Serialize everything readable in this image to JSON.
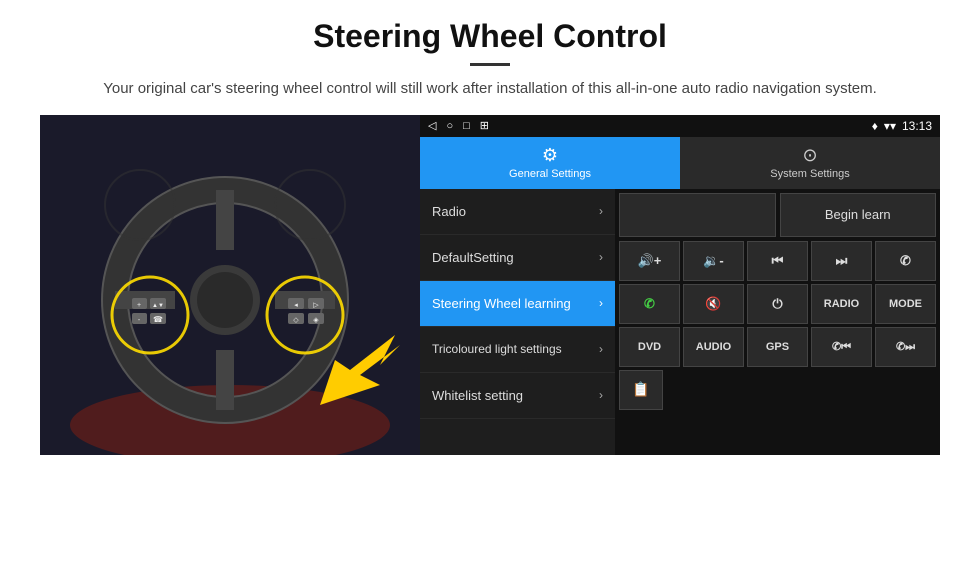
{
  "header": {
    "title": "Steering Wheel Control",
    "subtitle": "Your original car's steering wheel control will still work after installation of this all-in-one auto radio navigation system."
  },
  "status_bar": {
    "back_icon": "◁",
    "home_icon": "○",
    "square_icon": "□",
    "grid_icon": "⊞",
    "signal_icon": "▾",
    "wifi_icon": "▾",
    "time": "13:13"
  },
  "tabs": [
    {
      "id": "general",
      "label": "General Settings",
      "icon": "⚙",
      "active": true
    },
    {
      "id": "system",
      "label": "System Settings",
      "icon": "⊕",
      "active": false
    }
  ],
  "menu_items": [
    {
      "id": "radio",
      "label": "Radio",
      "active": false
    },
    {
      "id": "default",
      "label": "DefaultSetting",
      "active": false
    },
    {
      "id": "steering",
      "label": "Steering Wheel learning",
      "active": true
    },
    {
      "id": "tricoloured",
      "label": "Tricoloured light settings",
      "active": false
    },
    {
      "id": "whitelist",
      "label": "Whitelist setting",
      "active": false
    }
  ],
  "controls": {
    "begin_learn_label": "Begin learn",
    "buttons_row1": [
      {
        "id": "vol_up",
        "label": "◀+",
        "symbol": "🔊+"
      },
      {
        "id": "vol_down",
        "label": "◀-",
        "symbol": "🔉"
      },
      {
        "id": "prev_track",
        "label": "⏮",
        "symbol": "⏮"
      },
      {
        "id": "next_track",
        "label": "⏭",
        "symbol": "⏭"
      },
      {
        "id": "phone",
        "label": "✆",
        "symbol": "✆"
      }
    ],
    "buttons_row2": [
      {
        "id": "call_answer",
        "label": "✆",
        "symbol": "✆"
      },
      {
        "id": "mute",
        "label": "🔇",
        "symbol": "🔇"
      },
      {
        "id": "power",
        "label": "⏻",
        "symbol": "⏻"
      },
      {
        "id": "radio_btn",
        "label": "RADIO",
        "symbol": "RADIO"
      },
      {
        "id": "mode",
        "label": "MODE",
        "symbol": "MODE"
      }
    ],
    "buttons_row3": [
      {
        "id": "dvd",
        "label": "DVD"
      },
      {
        "id": "audio",
        "label": "AUDIO"
      },
      {
        "id": "gps",
        "label": "GPS"
      },
      {
        "id": "phone_prev",
        "label": "✆⏮"
      },
      {
        "id": "phone_next",
        "label": "✆⏭"
      }
    ],
    "whitelist_icon": "📋"
  }
}
